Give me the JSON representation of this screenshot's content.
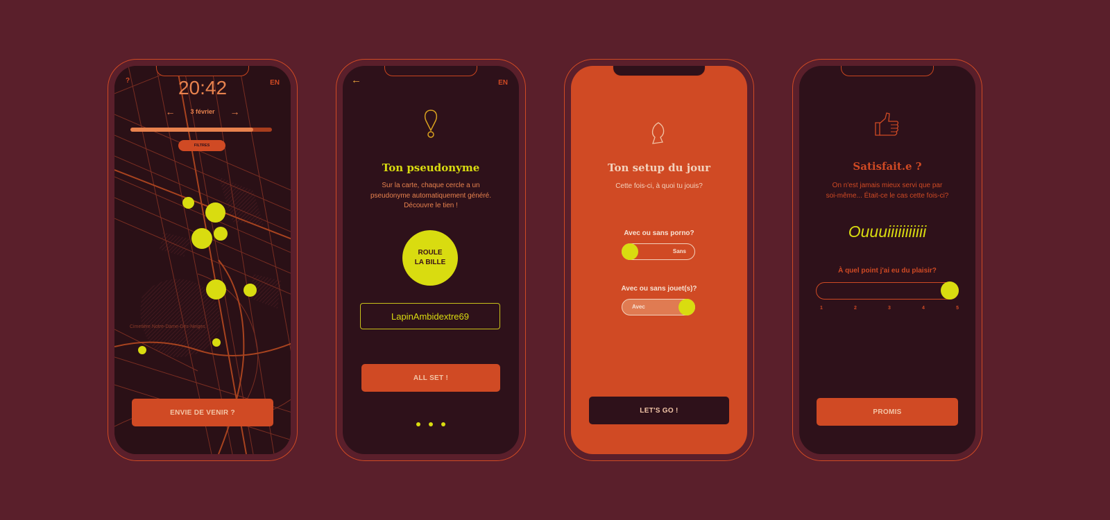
{
  "colors": {
    "background": "#5a1f2b",
    "accent": "#d04a24",
    "highlight": "#d9dc10",
    "screen_dark": "#2e111a"
  },
  "phone1": {
    "help": "?",
    "lang": "EN",
    "time": "20:42",
    "date": "3 février",
    "filter_label": "FILTRES",
    "progress": 0.87,
    "map_label": "Cimetière Notre-Dame-Des-Neiges",
    "cta": "ENVIE DE VENIR ?"
  },
  "phone2": {
    "lang": "EN",
    "title": "Ton pseudonyme",
    "desc": [
      "Sur la carte, chaque cercle a un",
      "pseudonyme automatiquement généré.",
      "Découvre le tien !"
    ],
    "roll_line1": "ROULE",
    "roll_line2": "LA BILLE",
    "pseudo": "LapinAmbidextre69",
    "cta": "ALL SET !"
  },
  "phone3": {
    "title": "Ton setup du jour",
    "subtitle": "Cette fois-ci, à quoi tu jouis?",
    "q1": "Avec ou sans porno?",
    "q1_value": "Sans",
    "q2": "Avec ou sans jouet(s)?",
    "q2_value": "Avec",
    "cta": "LET'S GO !"
  },
  "phone4": {
    "title": "Satisfait.e ?",
    "desc": [
      "On n'est jamais mieux servi que par",
      "soi-même... Était-ce le cas cette fois-ci?"
    ],
    "answer": "Ouuuiiiiiiiiiii",
    "question": "À quel point j'ai eu du plaisir?",
    "scale": [
      "1",
      "2",
      "3",
      "4",
      "5"
    ],
    "rating": 5,
    "cta": "PROMIS"
  }
}
